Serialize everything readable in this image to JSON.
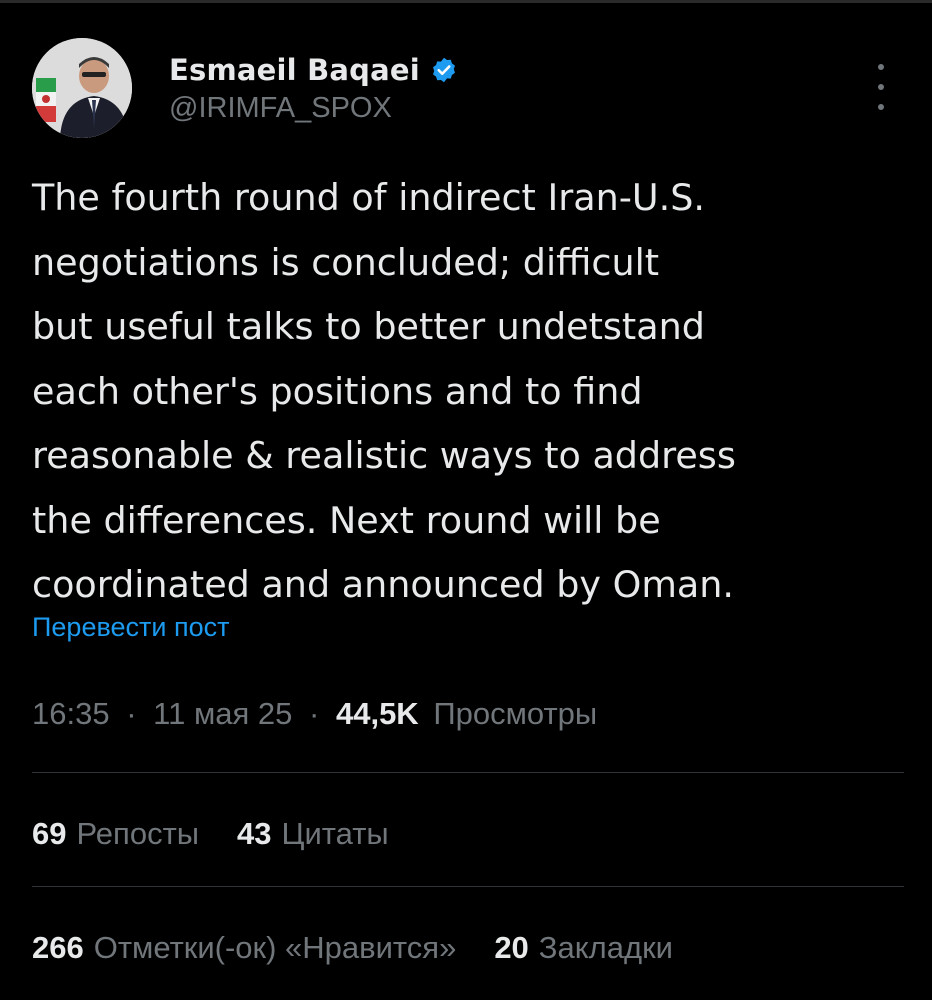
{
  "tweet": {
    "author": {
      "display_name": "Esmaeil Baqaei",
      "handle": "@IRIMFA_SPOX",
      "verified": true,
      "verified_color": "#1d9bf0"
    },
    "text_lines": [
      "The fourth round of indirect Iran-U.S.",
      "negotiations is concluded; difficult",
      "but useful talks to better undetstand",
      "each other's positions and to find",
      "reasonable & realistic ways to address",
      "the differences. Next round will be",
      "coordinated and announced by Oman."
    ],
    "translate_label": "Перевести пост",
    "time": "16:35",
    "date": "11 мая 25",
    "separator": "·",
    "views_count": "44,5K",
    "views_label": "Просмотры",
    "stats_row1": [
      {
        "count": "69",
        "label": "Репосты"
      },
      {
        "count": "43",
        "label": "Цитаты"
      }
    ],
    "stats_row2": [
      {
        "count": "266",
        "label": "Отметки(-ок) «Нравится»"
      },
      {
        "count": "20",
        "label": "Закладки"
      }
    ],
    "icons": {
      "verified": "verified-badge-icon",
      "more": "more-vertical-icon"
    },
    "colors": {
      "background": "#000000",
      "text": "#e7e9ea",
      "secondary": "#71767b",
      "link": "#1d9bf0",
      "divider": "#2f3336"
    }
  }
}
